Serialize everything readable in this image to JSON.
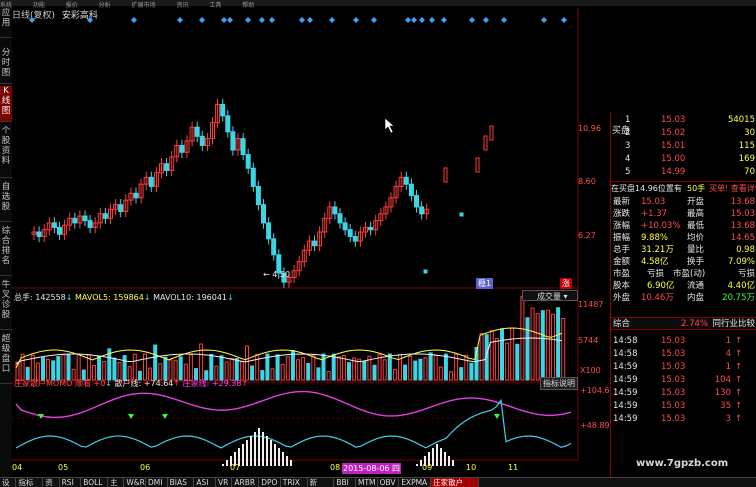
{
  "menubar": [
    "系统",
    "功能",
    "报价",
    "分析",
    "扩展市场",
    "资讯",
    "工具",
    "帮助"
  ],
  "title": {
    "name": "日线(复权)",
    "indicator": "安彩高科"
  },
  "left_tabs": [
    "应用",
    "分时图",
    "K线图",
    "个股资料",
    "自选股",
    "综合排名",
    "牛叉诊股",
    "超级盘口"
  ],
  "left_tabs_active": 2,
  "price_axis": [
    "10.96",
    "8.60",
    "6.27"
  ],
  "low_marker": "4.50",
  "vol_legend": {
    "total": "总手: 142558",
    "ma5": "MAVOL5: 159864",
    "ma10": "MAVOL10: 196041"
  },
  "vol_axis": [
    "11487",
    "5744",
    "X100"
  ],
  "vol_dropdown": "成交量",
  "momo_legend": {
    "name": "庄家散户MOMO 顺看",
    "v0": "+0",
    "retail": "散户线: +74.64",
    "banker": "庄家线: +29.38"
  },
  "indicator_help": "指标说明",
  "momo_axis": [
    "+104.6",
    "+48.89"
  ],
  "x_axis": [
    "04",
    "05",
    "06",
    "07",
    "08",
    "09",
    "10",
    "11"
  ],
  "date_marker": "2015-08-06 四",
  "badges": {
    "stable": "稳1",
    "up": "涨"
  },
  "orderbook": {
    "buy": [
      {
        "level": "1",
        "price": "15.03",
        "vol": "54015"
      },
      {
        "level": "2",
        "price": "15.02",
        "vol": "30"
      },
      {
        "level": "3",
        "price": "15.01",
        "vol": "115"
      },
      {
        "level": "4",
        "price": "15.00",
        "vol": "169"
      },
      {
        "level": "5",
        "price": "14.99",
        "vol": "70"
      }
    ],
    "side_label": "买盘",
    "note": "在买盘14.96位置有",
    "note_vol": "50手",
    "note_link": "买单! 查看详情"
  },
  "stats": [
    {
      "k1": "最新",
      "v1": "15.03",
      "k2": "开盘",
      "v2": "13.68"
    },
    {
      "k1": "涨跌",
      "v1": "+1.37",
      "k2": "最高",
      "v2": "15.03"
    },
    {
      "k1": "涨幅",
      "v1": "+10.03%",
      "k2": "最低",
      "v2": "13.68"
    },
    {
      "k1": "振幅",
      "v1": "9.88%",
      "k2": "均价",
      "v2": "14.65"
    },
    {
      "k1": "总手",
      "v1": "31.21万",
      "k2": "量比",
      "v2": "0.98"
    },
    {
      "k1": "金额",
      "v1": "4.58亿",
      "k2": "换手",
      "v2": "7.09%"
    },
    {
      "k1": "市盈",
      "v1": "亏损",
      "k2": "市盈(动)",
      "v2": "亏损"
    },
    {
      "k1": "股本",
      "v1": "6.90亿",
      "k2": "流通",
      "v2": "4.40亿"
    },
    {
      "k1": "外盘",
      "v1": "10.46万",
      "k2": "内盘",
      "v2": "20.75万"
    }
  ],
  "compare": {
    "label": "综合",
    "pct": "2.74%",
    "link": "同行业比较"
  },
  "ticks": [
    {
      "time": "14:58",
      "price": "15.03",
      "vol": "1"
    },
    {
      "time": "14:58",
      "price": "15.03",
      "vol": "4"
    },
    {
      "time": "14:59",
      "price": "15.03",
      "vol": "1"
    },
    {
      "time": "14:59",
      "price": "15.03",
      "vol": "104"
    },
    {
      "time": "14:59",
      "price": "15.03",
      "vol": "130"
    },
    {
      "time": "14:59",
      "price": "15.03",
      "vol": "35"
    },
    {
      "time": "14:59",
      "price": "15.03",
      "vol": "3"
    }
  ],
  "bottom_tabs": [
    "设置",
    "指标平台",
    "资金",
    "RSI",
    "BOLL",
    "主力",
    "W&R",
    "DMI",
    "BIAS",
    "ASI",
    "VR",
    "ARBR",
    "DPO",
    "TRIX",
    "新DMA",
    "BBI",
    "MTM",
    "OBV",
    "EXPMA",
    "庄家散户MOMO"
  ],
  "bottom_tabs_active": 19,
  "watermark": "www.7gpzb.com",
  "colors": {
    "up": "#ff3b3b",
    "down": "#3ad6e6",
    "banker": "#e040e0",
    "retail": "#40d0e8",
    "grid": "#7a0000"
  }
}
